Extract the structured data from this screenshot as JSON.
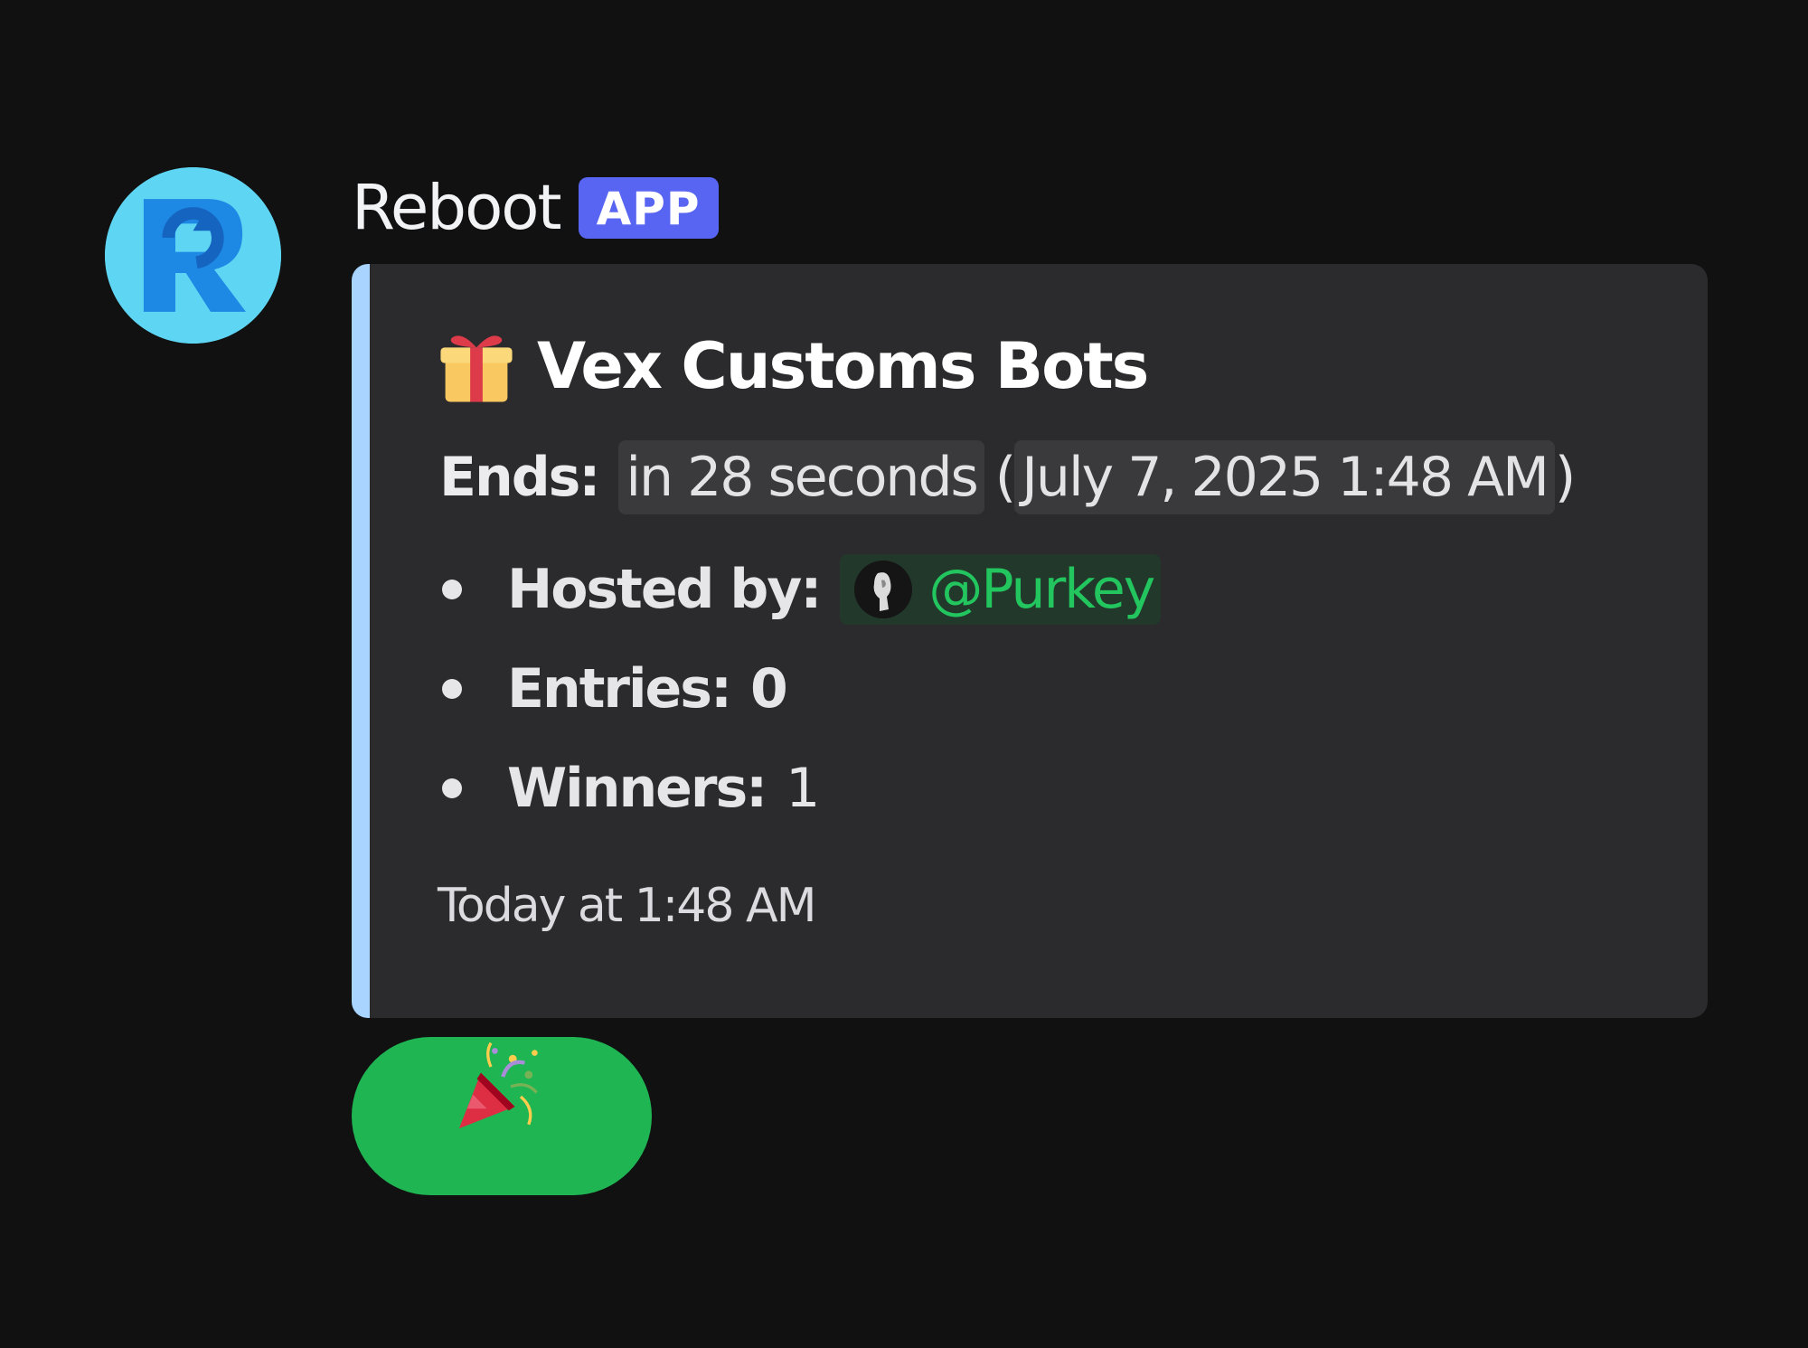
{
  "message": {
    "author": "Reboot",
    "badge": "APP",
    "avatar_icon": "reboot-logo-icon",
    "avatar_color": "#5ed6f3"
  },
  "embed": {
    "accent_color": "#a8d4ff",
    "title_icon": "gift-icon",
    "title": "Vex Customs Bots",
    "ends_label": "Ends:",
    "ends_relative": "in 28 seconds",
    "ends_absolute_open": "(",
    "ends_absolute": "July 7, 2025 1:48 AM",
    "ends_absolute_close": ")",
    "fields": [
      {
        "label": "Hosted by:",
        "value": "@Purkey",
        "type": "mention"
      },
      {
        "label": "Entries:",
        "value": "0",
        "type": "bold"
      },
      {
        "label": "Winners:",
        "value": "1",
        "type": "plain"
      }
    ],
    "footer": "Today at 1:48 AM"
  },
  "button": {
    "icon": "party-popper-icon",
    "color": "#1fb553"
  }
}
